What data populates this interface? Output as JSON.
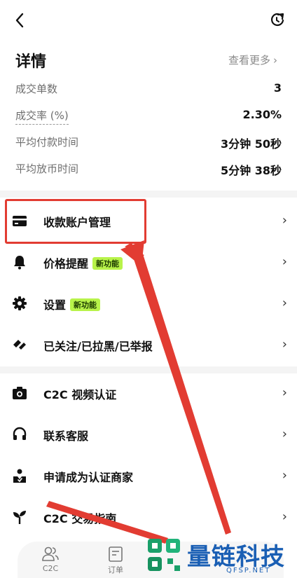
{
  "header": {
    "back_icon": "chevron-left-icon",
    "refresh_icon": "refresh-icon"
  },
  "details": {
    "title": "详情",
    "more_label": "查看更多",
    "stats": [
      {
        "label": "成交单数",
        "value": "3"
      },
      {
        "label": "成交率 (%)",
        "value": "2.30%"
      },
      {
        "label": "平均付款时间",
        "value": "3分钟 50秒"
      },
      {
        "label": "平均放币时间",
        "value": "5分钟 38秒"
      }
    ]
  },
  "menu": {
    "group1": [
      {
        "label": "收款账户管理",
        "icon": "card-icon"
      },
      {
        "label": "价格提醒",
        "icon": "bell-icon",
        "badge": "新功能"
      },
      {
        "label": "设置",
        "icon": "gear-icon",
        "badge": "新功能"
      },
      {
        "label": "已关注/已拉黑/已举报",
        "icon": "tag-icon"
      }
    ],
    "group2": [
      {
        "label": "C2C 视频认证",
        "icon": "camera-icon"
      },
      {
        "label": "联系客服",
        "icon": "headset-icon"
      },
      {
        "label": "申请成为认证商家",
        "icon": "merchant-icon"
      },
      {
        "label": "C2C 交易指南",
        "icon": "sprout-icon"
      }
    ]
  },
  "bottom_nav": {
    "tabs": [
      {
        "label": "C2C",
        "icon": "users-icon"
      },
      {
        "label": "订单",
        "icon": "order-icon"
      }
    ]
  },
  "watermark": {
    "text": "量链科技",
    "url": "QFSP.NET"
  },
  "colors": {
    "accent_badge": "#b8f34a",
    "annotation": "#e23c32",
    "watermark": "#1a5fb4"
  }
}
